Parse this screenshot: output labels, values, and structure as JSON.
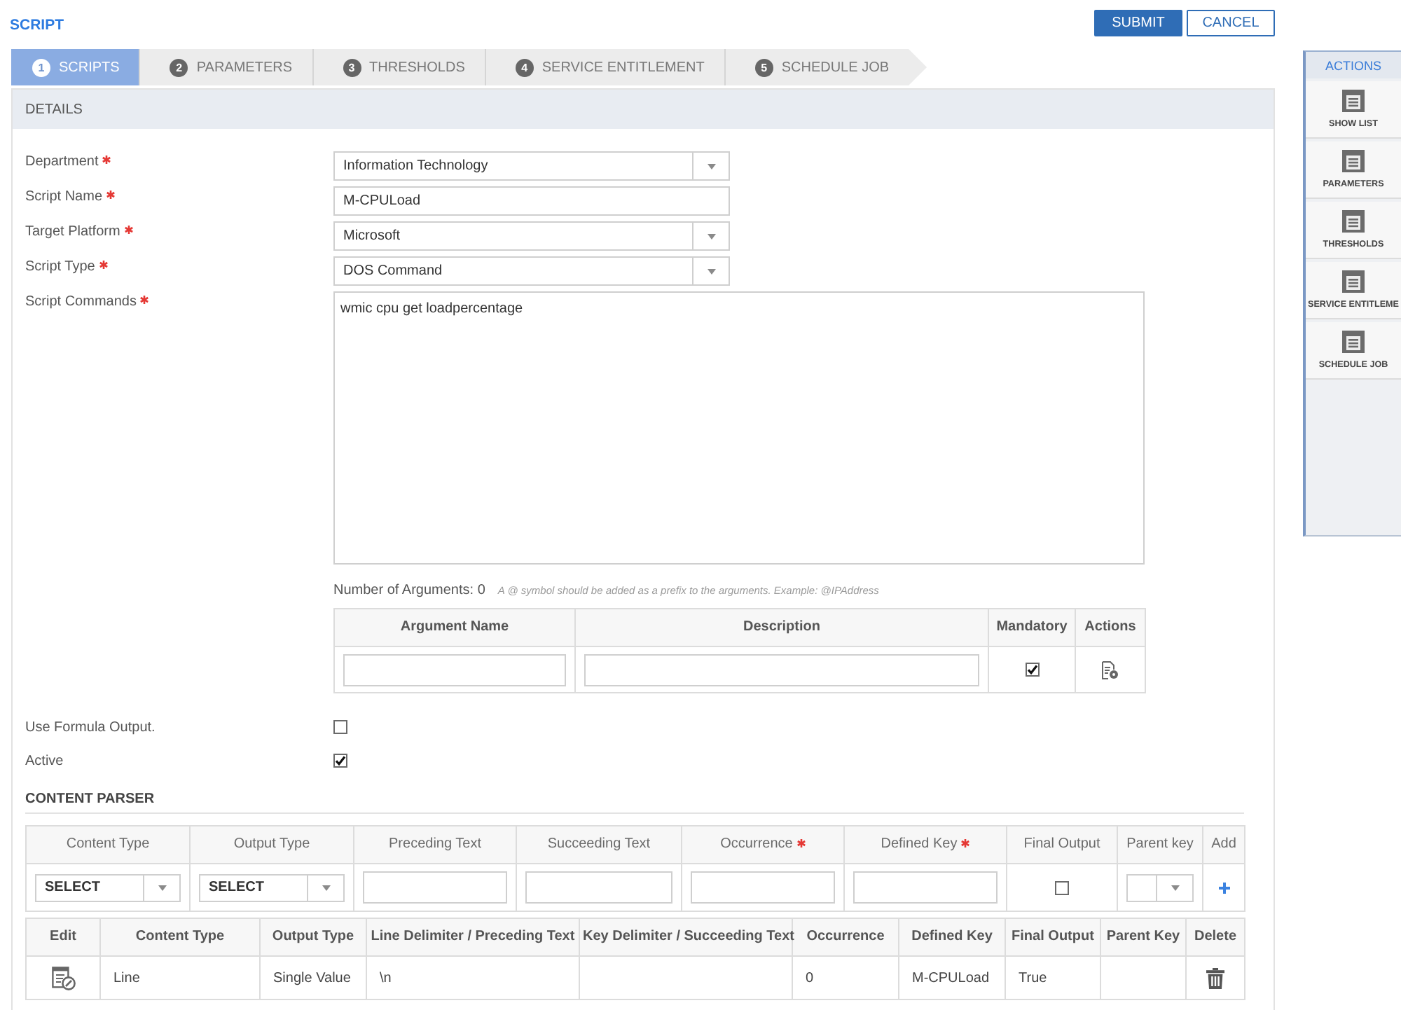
{
  "header": {
    "title": "SCRIPT",
    "buttons": [
      {
        "label": "SUBMIT",
        "kind": "primary"
      },
      {
        "label": "CANCEL",
        "kind": "secondary"
      }
    ]
  },
  "tabs": [
    {
      "number": "1",
      "label": "SCRIPTS",
      "selected": true
    },
    {
      "number": "2",
      "label": "PARAMETERS",
      "selected": false
    },
    {
      "number": "3",
      "label": "THRESHOLDS",
      "selected": false
    },
    {
      "number": "4",
      "label": "SERVICE ENTITLEMENT",
      "selected": false
    },
    {
      "number": "5",
      "label": "SCHEDULE JOB",
      "selected": false
    }
  ],
  "details": {
    "title": "DETAILS",
    "fields": [
      {
        "kind": "select",
        "label": "Department",
        "required": true,
        "value": "Information Technology"
      },
      {
        "kind": "text",
        "label": "Script Name",
        "required": true,
        "value": "M-CPULoad"
      },
      {
        "kind": "select",
        "label": "Target Platform",
        "required": true,
        "value": "Microsoft"
      },
      {
        "kind": "select",
        "label": "Script Type",
        "required": true,
        "value": "DOS Command"
      },
      {
        "kind": "textarea",
        "label": "Script Commands",
        "required": true,
        "value": "wmic cpu get loadpercentage"
      }
    ],
    "arguments": {
      "label": "Number of Arguments:",
      "count": "0",
      "hint": "A @ symbol should be added as a prefix to the arguments. Example: @IPAddress",
      "columns": [
        "Argument Name",
        "Description",
        "Mandatory",
        "Actions"
      ],
      "cells": [
        {
          "kind": "input"
        },
        {
          "kind": "input"
        },
        {
          "kind": "checkbox",
          "checked": true
        },
        {
          "kind": "action"
        }
      ]
    },
    "options": [
      {
        "label": "Use Formula Output.",
        "checked": false
      },
      {
        "label": "Active",
        "checked": true
      }
    ]
  },
  "content_parser": {
    "title": "CONTENT PARSER",
    "entry_table": {
      "columns": [
        {
          "label": "Content Type",
          "required": false
        },
        {
          "label": "Output Type",
          "required": false
        },
        {
          "label": "Preceding Text",
          "required": false
        },
        {
          "label": "Succeeding Text",
          "required": false
        },
        {
          "label": "Occurrence",
          "required": true
        },
        {
          "label": "Defined Key",
          "required": true
        },
        {
          "label": "Final Output",
          "required": false
        },
        {
          "label": "Parent key",
          "required": false
        },
        {
          "label": "Add",
          "required": false
        }
      ],
      "cells": [
        {
          "kind": "select",
          "value": "SELECT"
        },
        {
          "kind": "select",
          "value": "SELECT"
        },
        {
          "kind": "input"
        },
        {
          "kind": "input"
        },
        {
          "kind": "input"
        },
        {
          "kind": "input"
        },
        {
          "kind": "checkbox",
          "checked": false
        },
        {
          "kind": "select"
        },
        {
          "kind": "add"
        }
      ]
    },
    "results_table": {
      "columns": [
        "Edit",
        "Content Type",
        "Output Type",
        "Line Delimiter / Preceding Text",
        "Key Delimiter / Succeeding Text",
        "Occurrence",
        "Defined Key",
        "Final Output",
        "Parent Key",
        "Delete"
      ],
      "rows": [
        {
          "cells": [
            {
              "kind": "edit"
            },
            {
              "kind": "text",
              "text": "Line"
            },
            {
              "kind": "text",
              "text": "Single Value"
            },
            {
              "kind": "text",
              "text": "\\n"
            },
            {
              "kind": "empty"
            },
            {
              "kind": "text",
              "text": "0"
            },
            {
              "kind": "text",
              "text": "M-CPULoad"
            },
            {
              "kind": "text",
              "text": "True"
            },
            {
              "kind": "empty"
            },
            {
              "kind": "delete"
            }
          ]
        }
      ]
    }
  },
  "actions": {
    "title": "ACTIONS",
    "items": [
      "SHOW LIST",
      "PARAMETERS",
      "THRESHOLDS",
      "SERVICE ENTITLEME",
      "SCHEDULE JOB"
    ]
  }
}
